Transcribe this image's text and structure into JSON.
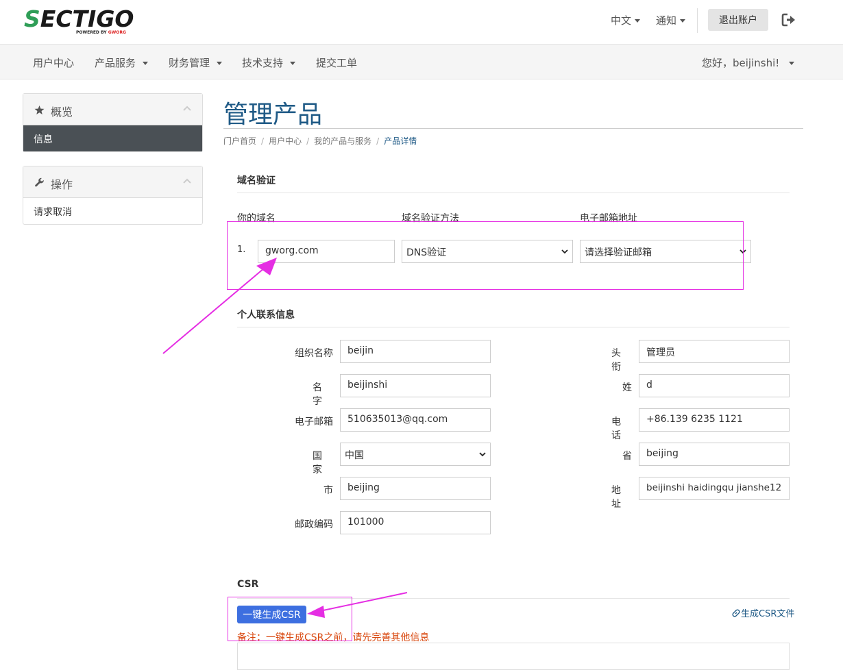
{
  "brand": {
    "logo_text": "SECTIGO",
    "logo_sub": "POWERED BY GWORG",
    "accent": "#2f9e57"
  },
  "header": {
    "lang": "中文",
    "notify": "通知",
    "logout": "退出账户"
  },
  "nav": {
    "items": [
      "用户中心",
      "产品服务",
      "财务管理",
      "技术支持",
      "提交工单"
    ],
    "user": "您好，beijinshi!"
  },
  "sidebar": {
    "overview": {
      "title": "概览",
      "items": [
        "信息"
      ]
    },
    "actions": {
      "title": "操作",
      "items": [
        "请求取消"
      ]
    }
  },
  "page": {
    "title": "管理产品"
  },
  "breadcrumb": [
    "门户首页",
    "用户中心",
    "我的产品与服务",
    "产品详情"
  ],
  "domain_section": {
    "title": "域名验证",
    "col_domain": "你的域名",
    "col_method": "域名验证方法",
    "col_email": "电子邮箱地址",
    "row_num": "1.",
    "domain_value": "gworg.com",
    "method_value": "DNS验证",
    "email_value": "请选择验证邮箱"
  },
  "contact_section": {
    "title": "个人联系信息",
    "org_label": "组织名称",
    "org_value": "beijin",
    "title_label": "头 衔",
    "title_value": "管理员",
    "name_label": "名 字",
    "name_value": "beijinshi",
    "surname_label": "姓",
    "surname_value": "d",
    "email_label": "电子邮箱",
    "email_value": "510635013@qq.com",
    "phone_label": "电 话",
    "phone_value": "+86.139 6235 1121",
    "country_label": "国 家",
    "country_value": "中国",
    "province_label": "省",
    "province_value": "beijing",
    "city_label": "市",
    "city_value": "beijing",
    "address_label": "地 址",
    "address_value": "beijinshi haidingqu jianshe12",
    "zip_label": "邮政编码",
    "zip_value": "101000"
  },
  "csr_section": {
    "title": "CSR",
    "generate_button": "一键生成CSR",
    "file_link": "生成CSR文件",
    "note": "备注：一键生成CSR之前，请先完善其他信息"
  },
  "colors": {
    "annotation": "#e52ee3",
    "title": "#1f5a86",
    "button": "#3d6fe0",
    "note": "#d9480f"
  }
}
